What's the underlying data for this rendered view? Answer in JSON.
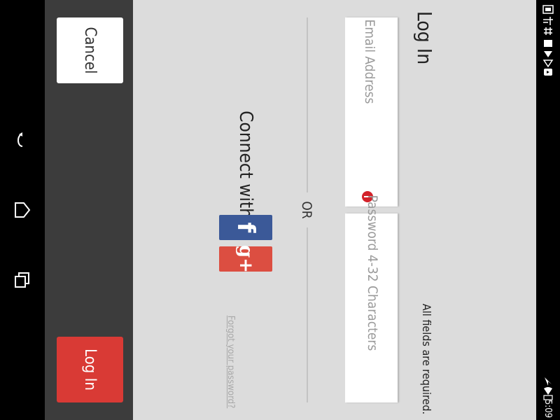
{
  "nav": {
    "back_glyph": "↶",
    "home_glyph": "⌂",
    "recent_glyph": "❐"
  },
  "actions": {
    "cancel_label": "Cancel",
    "login_label": "Log In"
  },
  "form": {
    "title": "Log In",
    "email_placeholder": "Email Address",
    "password_placeholder": "Password 4-32 Characters",
    "required_note": "All fields are required.",
    "or_label": "OR",
    "connect_label": "Connect with:",
    "forgot_link": "Forgot your password?"
  },
  "social": {
    "facebook_glyph": "f",
    "googleplus_glyph": "g+"
  },
  "status": {
    "time": "5:09"
  },
  "colors": {
    "action_bar": "#3c3c3c",
    "content_bg": "#dcdcdc",
    "login_button": "#d93a35",
    "facebook": "#3b5998",
    "googleplus": "#dc4e41",
    "error_badge": "#d3222a"
  }
}
